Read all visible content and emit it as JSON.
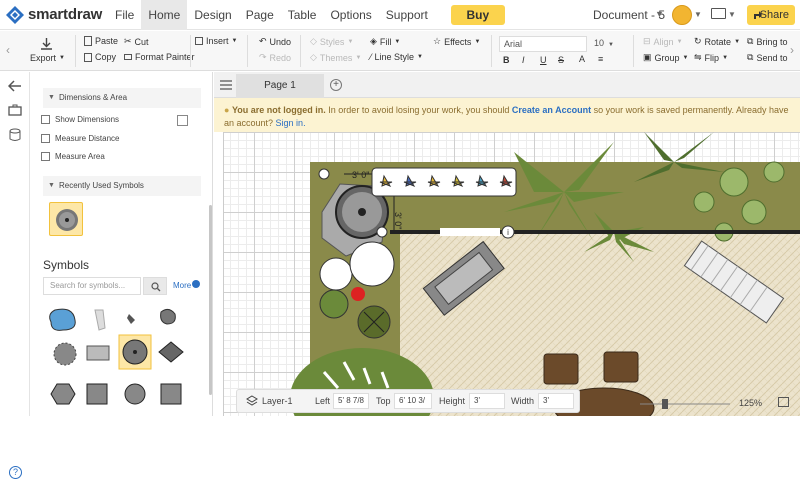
{
  "app": {
    "name": "smartdraw",
    "doc_title": "Document - 5"
  },
  "menu": [
    "File",
    "Home",
    "Design",
    "Page",
    "Table",
    "Options",
    "Support"
  ],
  "menu_active": "Home",
  "buttons": {
    "buy": "Buy",
    "share": "Share"
  },
  "ribbon": {
    "export": "Export",
    "paste": "Paste",
    "cut": "Cut",
    "copy": "Copy",
    "format_painter": "Format Painter",
    "insert": "Insert",
    "undo": "Undo",
    "redo": "Redo",
    "styles": "Styles",
    "themes": "Themes",
    "fill": "Fill",
    "line_style": "Line Style",
    "effects": "Effects",
    "font": "Arial",
    "font_size": "10",
    "bold": "B",
    "italic": "I",
    "underline": "U",
    "strike": "S",
    "align": "Align",
    "group": "Group",
    "rotate": "Rotate",
    "flip": "Flip",
    "bring_to": "Bring to",
    "send_to": "Send to"
  },
  "panel": {
    "dimensions_header": "Dimensions & Area",
    "show_dimensions": "Show Dimensions",
    "measure_distance": "Measure Distance",
    "measure_area": "Measure Area",
    "recent_header": "Recently Used Symbols",
    "symbols_title": "Symbols",
    "search_placeholder": "Search for symbols...",
    "more": "More"
  },
  "tabs": {
    "page1": "Page 1"
  },
  "notice": {
    "strong": "You are not logged in.",
    "text1": " In order to avoid losing your work, you should ",
    "link1": "Create an Account",
    "text2": " so your work is saved permanently. Already have an account? ",
    "link2": "Sign in."
  },
  "canvas": {
    "dim_label_top": "3' 0\"",
    "dim_label_side": "3' 0\""
  },
  "bottom": {
    "layer": "Layer-1",
    "left_label": "Left",
    "left_value": "5' 8 7/8",
    "top_label": "Top",
    "top_value": "6' 10 3/",
    "height_label": "Height",
    "height_value": "3'",
    "width_label": "Width",
    "width_value": "3'",
    "zoom": "125%"
  },
  "colors": {
    "accent_yellow": "#fbd34d",
    "brand_blue": "#2b6fc2",
    "lawn": "#8a8a4a",
    "patio": "#ece3cc",
    "palm": "#6b8a3a"
  }
}
